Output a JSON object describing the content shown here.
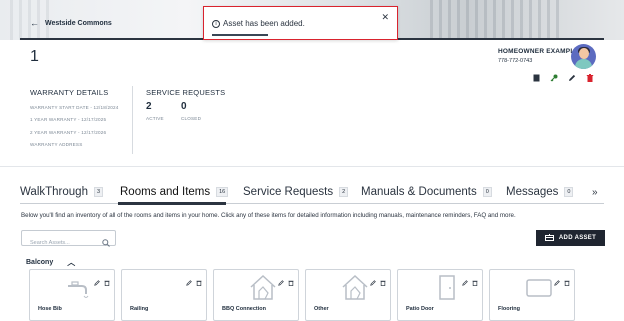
{
  "header": {
    "back_label": "Westside Commons",
    "unit_number": "1",
    "owner_name": "HOMEOWNER EXAMPLE",
    "owner_phone": "778-772-0743"
  },
  "toast": {
    "message": "Asset has been added."
  },
  "warranty": {
    "title": "WARRANTY DETAILS",
    "start": "WARRANTY START DATE - 12/18/2024",
    "one_year": "1 YEAR WARRANTY - 12/17/2025",
    "two_year": "2 YEAR WARRANTY - 12/17/2026",
    "address": "WARRANTY ADDRESS"
  },
  "service": {
    "title": "SERVICE REQUESTS",
    "active_count": "2",
    "active_label": "ACTIVE",
    "closed_count": "0",
    "closed_label": "CLOSED"
  },
  "tabs": [
    {
      "label": "WalkThrough",
      "count": "3"
    },
    {
      "label": "Rooms and Items",
      "count": "16"
    },
    {
      "label": "Service Requests",
      "count": "2"
    },
    {
      "label": "Manuals & Documents",
      "count": "0"
    },
    {
      "label": "Messages",
      "count": "0"
    }
  ],
  "more_symbol": "»",
  "description": "Below you'll find an inventory of all of the rooms and items in your home. Click any of these items for detailed information including manuals, maintenance reminders, FAQ and more.",
  "search": {
    "placeholder": "Search Assets..."
  },
  "add_asset_label": "ADD ASSET",
  "category": {
    "name": "Balcony"
  },
  "assets": [
    {
      "label": "Hose Bib",
      "icon": "faucet-icon"
    },
    {
      "label": "Railing",
      "icon": "blank"
    },
    {
      "label": "BBQ Connection",
      "icon": "house-icon"
    },
    {
      "label": "Other",
      "icon": "house-icon"
    },
    {
      "label": "Patio Door",
      "icon": "door-icon"
    },
    {
      "label": "Flooring",
      "icon": "floor-icon"
    }
  ],
  "colors": {
    "accent_dark": "#1f2530",
    "toast_border": "#d9232e",
    "delete_red": "#d9232e",
    "key_green": "#2e7d32"
  }
}
